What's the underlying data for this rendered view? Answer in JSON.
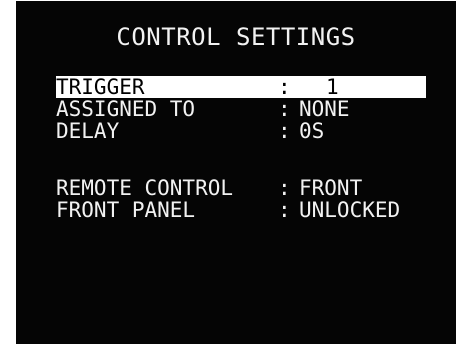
{
  "screen": {
    "title": "CONTROL SETTINGS",
    "settings": [
      {
        "label": "TRIGGER",
        "separator": ":",
        "value": "1"
      },
      {
        "label": "ASSIGNED TO",
        "separator": ":",
        "value": "NONE"
      },
      {
        "label": "DELAY",
        "separator": ":",
        "value": "0S"
      },
      {
        "label": "REMOTE CONTROL",
        "separator": ":",
        "value": "FRONT"
      },
      {
        "label": "FRONT PANEL",
        "separator": ":",
        "value": "UNLOCKED"
      }
    ]
  },
  "colors": {
    "background": "#050505",
    "text": "#f2f2f2",
    "highlight": "#ffffff"
  }
}
